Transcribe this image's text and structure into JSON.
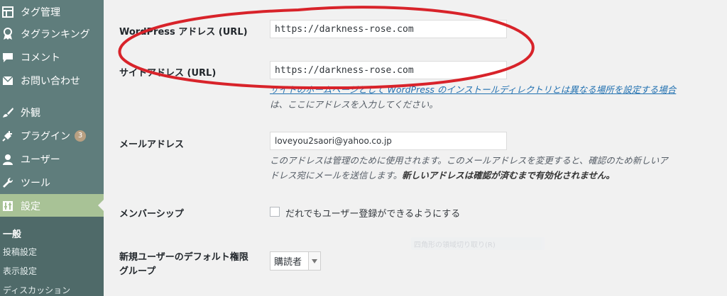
{
  "sidebar": {
    "items": [
      {
        "label": "タグ管理",
        "icon": "table-icon"
      },
      {
        "label": "タグランキング",
        "icon": "award-icon"
      },
      {
        "label": "コメント",
        "icon": "comment-icon"
      },
      {
        "label": "お問い合わせ",
        "icon": "mail-icon"
      },
      {
        "label": "外観",
        "icon": "brush-icon"
      },
      {
        "label": "プラグイン",
        "icon": "plugin-icon",
        "badge": "3"
      },
      {
        "label": "ユーザー",
        "icon": "user-icon"
      },
      {
        "label": "ツール",
        "icon": "wrench-icon"
      },
      {
        "label": "設定",
        "icon": "settings-icon",
        "active": true
      }
    ],
    "submenu": [
      {
        "label": "一般",
        "current": true
      },
      {
        "label": "投稿設定"
      },
      {
        "label": "表示設定"
      },
      {
        "label": "ディスカッション"
      }
    ]
  },
  "form": {
    "wp_address": {
      "label": "WordPress アドレス (URL)",
      "value": "https://darkness-rose.com"
    },
    "site_address": {
      "label": "サイトアドレス (URL)",
      "value": "https://darkness-rose.com",
      "desc_link": "サイトのホームページとして WordPress のインストールディレクトリとは異なる場所を設定する場合",
      "desc_rest": "は、ここにアドレスを入力してください。"
    },
    "email": {
      "label": "メールアドレス",
      "value": "loveyou2saori@yahoo.co.jp",
      "desc_line1": "このアドレスは管理のために使用されます。このメールアドレスを変更すると、確認のため新しいア",
      "desc_line2": "ドレス宛にメールを送信します。",
      "desc_bold": "新しいアドレスは確認が済むまで有効化されません。"
    },
    "membership": {
      "label": "メンバーシップ",
      "checkbox_label": "だれでもユーザー登録ができるようにする",
      "checked": false
    },
    "default_role": {
      "label_line1": "新規ユーザーのデフォルト権限",
      "label_line2": "グループ",
      "selected": "購読者"
    }
  },
  "overlay": {
    "ghost_text": "四角形の領域切り取り(R)",
    "annotation_color": "#d8232a"
  }
}
